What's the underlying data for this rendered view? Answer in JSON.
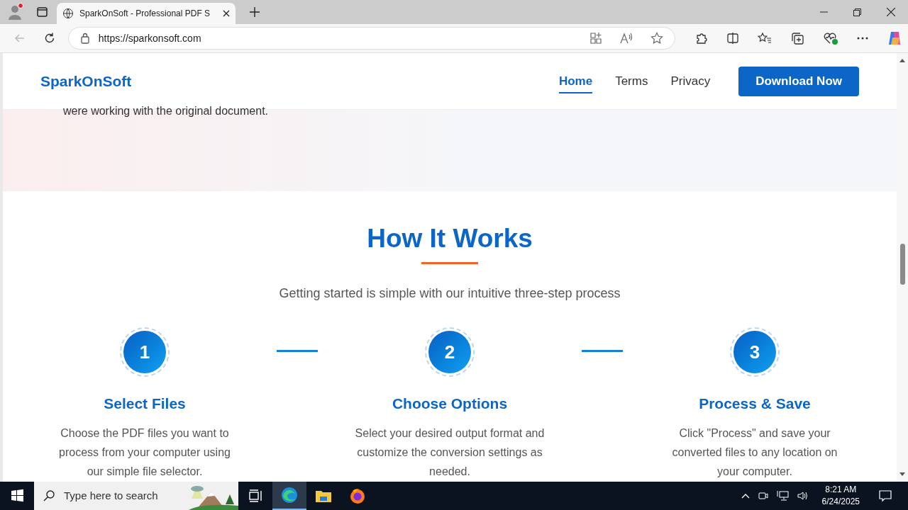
{
  "browser": {
    "tabs": [
      {
        "title": "SparkOnSoft - Professional PDF S",
        "selected": true
      }
    ],
    "url": "https://sparkonsoft.com"
  },
  "site": {
    "logo": "SparkOnSoft",
    "nav": [
      {
        "label": "Home",
        "selected": true
      },
      {
        "label": "Terms",
        "selected": false
      },
      {
        "label": "Privacy",
        "selected": false
      }
    ],
    "cta": "Download Now"
  },
  "intro_text": "were working with the original document.",
  "how_it_works": {
    "title": "How It Works",
    "subtitle": "Getting started is simple with our intuitive three-step process",
    "steps": [
      {
        "number": "1",
        "title": "Select Files",
        "description": "Choose the PDF files you want to process from your computer using our simple file selector."
      },
      {
        "number": "2",
        "title": "Choose Options",
        "description": "Select your desired output format and customize the conversion settings as needed."
      },
      {
        "number": "3",
        "title": "Process & Save",
        "description": "Click \"Process\" and save your converted files to any location on your computer."
      }
    ]
  },
  "taskbar": {
    "search_placeholder": "Type here to search",
    "apps": [
      {
        "kind": "taskview",
        "selected": false
      },
      {
        "kind": "edge",
        "selected": true
      },
      {
        "kind": "explorer",
        "selected": false
      },
      {
        "kind": "firefox",
        "selected": false
      }
    ],
    "time": "8:21 AM",
    "date": "6/24/2025"
  }
}
